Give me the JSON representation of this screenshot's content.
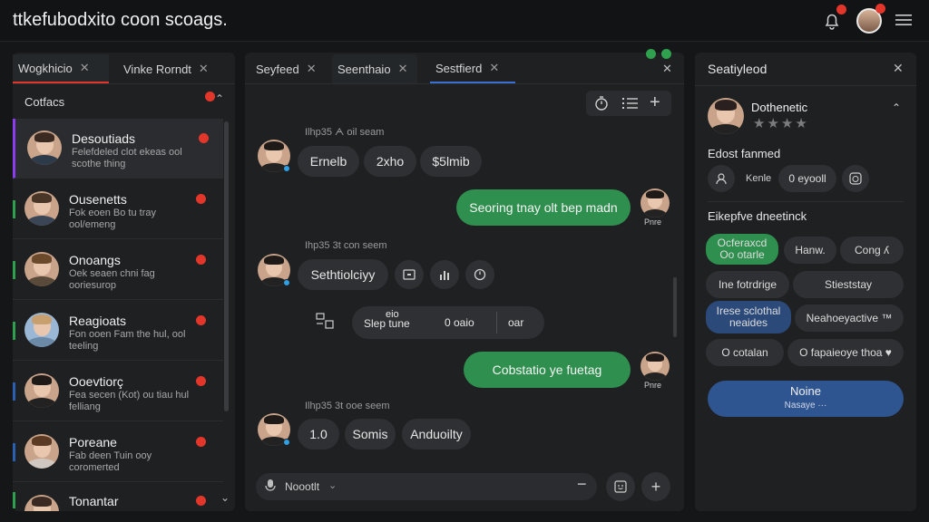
{
  "app": {
    "title": "ttkefubodxito coon scoags."
  },
  "left_panel": {
    "tabs": [
      {
        "label": "Wogkhicio"
      },
      {
        "label": "Vinke Rorndt"
      }
    ],
    "section_title": "Cotfacs",
    "contacts": [
      {
        "name": "Desoutiads",
        "sub": "Felefdeled clot ekeas ool scothe thing",
        "accent": "#8a3df0"
      },
      {
        "name": "Ousenetts",
        "sub": "Fok eoen Bo tu tray ool/emeng",
        "accent": "#2fa04e"
      },
      {
        "name": "Onoangs",
        "sub": "Oek seaen chni fag ooriesurop",
        "accent": "#2fa04e"
      },
      {
        "name": "Reagioats",
        "sub": "Fon ooen Fam the hul, ool teeling",
        "accent": "#2fa04e"
      },
      {
        "name": "Ooevtiorç",
        "sub": "Fea secen (Kot) ou tiau hul felliang",
        "accent": "#2b5fb0"
      },
      {
        "name": "Poreane",
        "sub": "Fab deen Tuin ooy coromerted",
        "accent": "#2b5fb0"
      },
      {
        "name": "Tonantar",
        "sub": "",
        "accent": "#2fa04e"
      }
    ]
  },
  "mid_panel": {
    "tabs": [
      {
        "label": "Seyfeed"
      },
      {
        "label": "Seenthaio"
      },
      {
        "label": "Sestfierd"
      }
    ],
    "msg1": {
      "meta": "Ilhp35 ᗅ oil seam",
      "pills": [
        "Ernelb",
        "2xho",
        "$5lmib"
      ]
    },
    "msg2": {
      "text": "Seoring tnay olt bep madn",
      "name": "Pnre"
    },
    "msg3": {
      "meta": "Ihp35 3t con seem",
      "pill": "Sethtiolciyy"
    },
    "msg4": {
      "top": "eio",
      "left": "Slep tune",
      "mid": "0 oaio",
      "right": "oar"
    },
    "msg5": {
      "text": "Cobstatio ye fuetag",
      "name": "Pnre"
    },
    "msg6": {
      "meta": "Ilhp35 3t ooe seem",
      "pills": [
        "1.0",
        "Somis",
        "Anduoilty"
      ]
    },
    "composer": {
      "label": "Noootlt"
    }
  },
  "right_panel": {
    "title": "Seatiyleod",
    "profile": {
      "name": "Dothenetic",
      "stars": "★★★★"
    },
    "section1": "Edost fanmed",
    "quick": {
      "label1": "Kenle",
      "label2": "0 eyooll"
    },
    "section2": "Eikepfve dneetinck",
    "buttons": [
      "Ocferaxcd Oo otarle",
      "Hanw.",
      "Cong ʎ",
      "Ine fotrdrige",
      "Stieststay",
      "Irese sclothal neaides",
      "Neahoeyactive ™",
      "O cotalan",
      "O fapaieoye thoa ♥"
    ],
    "primary": {
      "label": "Noine",
      "sub": "Nasaye ···"
    }
  }
}
